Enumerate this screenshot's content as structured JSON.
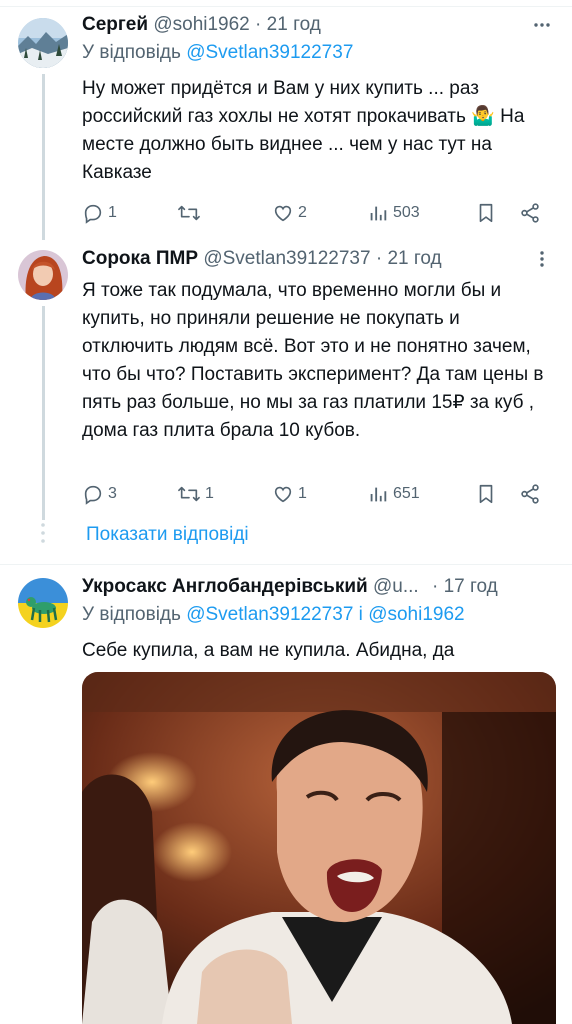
{
  "tweets": [
    {
      "author_name": "Сергей",
      "handle": "@sohi1962",
      "separator": "·",
      "time": "21 год",
      "reply_prefix": "У відповідь",
      "reply_to": "@Svetlan39122737",
      "text": "Ну может придётся и Вам у них купить ... раз российский газ хохлы не хотят прокачивать 🤷‍♂️ На месте должно быть виднее ... чем у нас тут на Кавказе",
      "replies": "1",
      "retweets": "",
      "likes": "2",
      "views": "503"
    },
    {
      "author_name": "Сорока ПМР",
      "handle": "@Svetlan39122737",
      "separator": "·",
      "time": "21 год",
      "text": "Я тоже так подумала, что временно могли бы и купить, но приняли решение не покупать и отключить людям всё. Вот это и не понятно зачем, что бы что? Поставить эксперимент? Да там цены в пять раз больше, но мы за газ платили 15₽ за куб , дома газ плита брала 10 кубов.",
      "replies": "3",
      "retweets": "1",
      "likes": "1",
      "views": "651"
    },
    {
      "author_name": "Укросакс Англобандерівський",
      "handle": "@u...",
      "separator": "·",
      "time": "17 год",
      "reply_prefix": "У відповідь",
      "reply_to": "@Svetlan39122737",
      "reply_conj": "і",
      "reply_to_2": "@sohi1962",
      "text": "Себе купила, а вам не купила. Абидна, да"
    }
  ],
  "show_replies_label": "Показати відповіді",
  "colors": {
    "accent": "#1d9bf0",
    "secondary_text": "#536471",
    "primary_text": "#0f1419",
    "divider": "#eff3f4"
  },
  "icons": [
    "reply-icon",
    "retweet-icon",
    "like-icon",
    "views-icon",
    "bookmark-icon",
    "share-icon",
    "more-icon"
  ]
}
